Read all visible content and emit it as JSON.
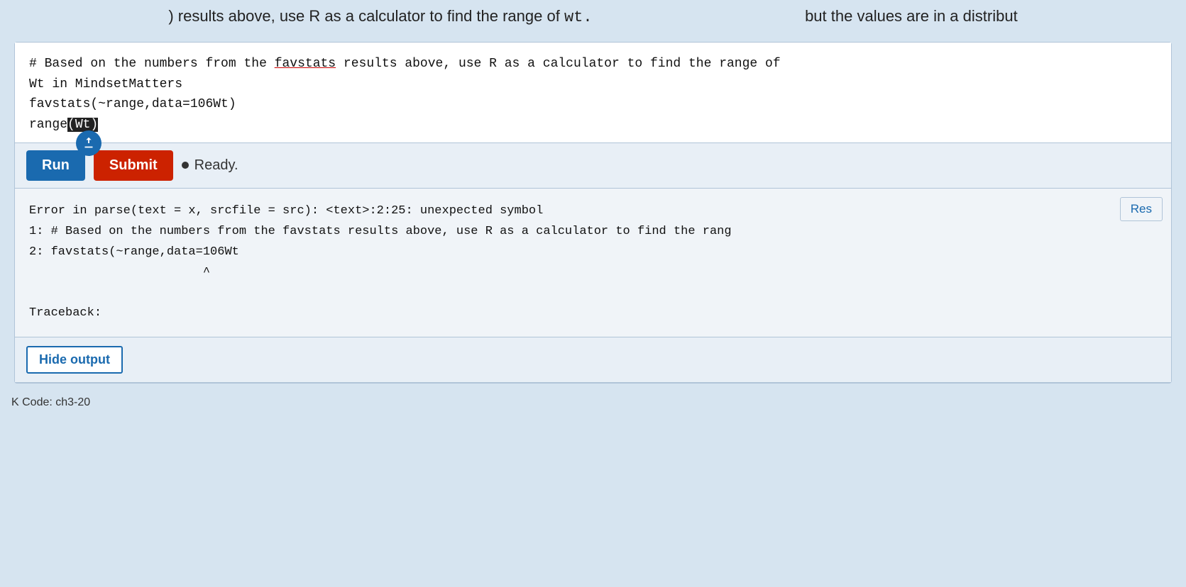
{
  "top_bar": {
    "text": ") results above, use R as a calculator to find the range of ",
    "wt": "wt.",
    "prefix": "but the values are in a distribut"
  },
  "code_editor": {
    "lines": [
      "# Based on the numbers from the favstats results above, use R as a calculator to find the range of",
      "Wt in MindsetMatters",
      "favstats(~range,data=106Wt)",
      "range(Wt)"
    ],
    "line1_prefix": "# Based on the numbers ",
    "line1_from": "from",
    "line1_middle": " the ",
    "line1_favstats": "favstats",
    "line1_suffix": " results above, use R as a calculator to find the range of",
    "line2": "Wt in MindsetMatters",
    "line3": "favstats(~range,data=106Wt)",
    "line4_prefix": "range",
    "line4_cursor": "(Wt)",
    "cursor_char": "|"
  },
  "toolbar": {
    "run_label": "Run",
    "submit_label": "Submit",
    "ready_label": "Ready."
  },
  "output": {
    "reset_label": "Res",
    "error_lines": [
      "Error in parse(text = x, srcfile = src): <text>:2:25: unexpected symbol",
      "1: # Based on the numbers from the favstats results above, use R as a calculator to find the rang",
      "2: favstats(~range,data=106Wt",
      "                        ^",
      "",
      "Traceback:"
    ]
  },
  "hide_output": {
    "label": "Hide output"
  },
  "footer": {
    "label": "K Code: ch3-20"
  }
}
